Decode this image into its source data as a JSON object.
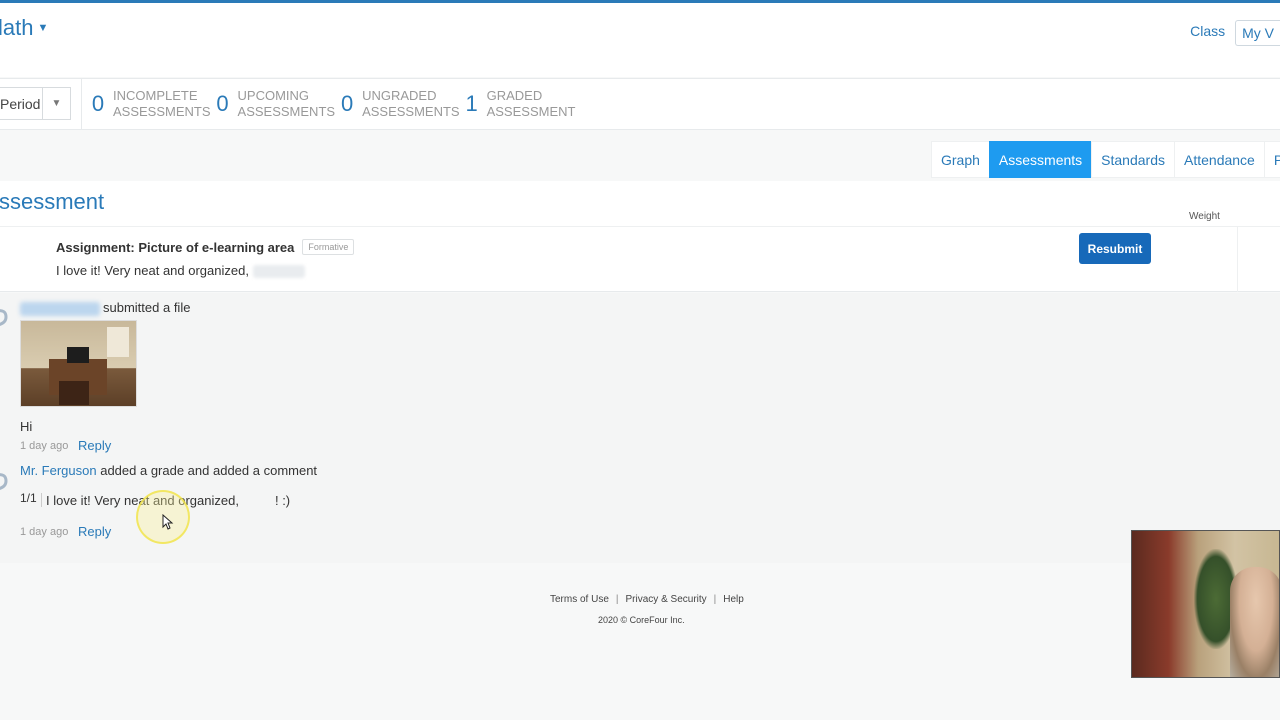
{
  "header": {
    "course_title": "lath",
    "nav": [
      {
        "label": "Class"
      },
      {
        "label": "My V"
      }
    ]
  },
  "summary": {
    "period_label": "Period",
    "stats": [
      {
        "count": "0",
        "line1": "INCOMPLETE",
        "line2": "ASSESSMENTS"
      },
      {
        "count": "0",
        "line1": "UPCOMING",
        "line2": "ASSESSMENTS"
      },
      {
        "count": "0",
        "line1": "UNGRADED",
        "line2": "ASSESSMENTS"
      },
      {
        "count": "1",
        "line1": "GRADED",
        "line2": "ASSESSMENT"
      }
    ]
  },
  "tabs": [
    {
      "label": "Graph",
      "active": false
    },
    {
      "label": "Assessments",
      "active": true
    },
    {
      "label": "Standards",
      "active": false
    },
    {
      "label": "Attendance",
      "active": false
    },
    {
      "label": "Pr",
      "active": false
    }
  ],
  "assessment": {
    "section_title": "ssessment",
    "weight_label": "Weight",
    "assignment_title": "Assignment: Picture of e-learning area",
    "badge": "Formative",
    "comment": "I love it! Very neat and organized,",
    "resubmit_label": "Resubmit"
  },
  "activity": {
    "submission": {
      "action": "submitted a file",
      "message": "Hi",
      "time": "1 day ago",
      "reply_label": "Reply"
    },
    "grade_entry": {
      "author": "Mr. Ferguson",
      "action": "added a grade and added a comment",
      "grade": "1/1",
      "comment_start": "I love it! Very neat and organized,",
      "comment_end": "! :)",
      "time": "1 day ago",
      "reply_label": "Reply"
    }
  },
  "footer": {
    "terms": "Terms of Use",
    "privacy": "Privacy & Security",
    "help": "Help",
    "separator": "|",
    "copyright": "2020 © CoreFour Inc."
  },
  "colors": {
    "accent": "#2a7ab8",
    "active_tab": "#1e9bf0",
    "button": "#1769b9"
  }
}
